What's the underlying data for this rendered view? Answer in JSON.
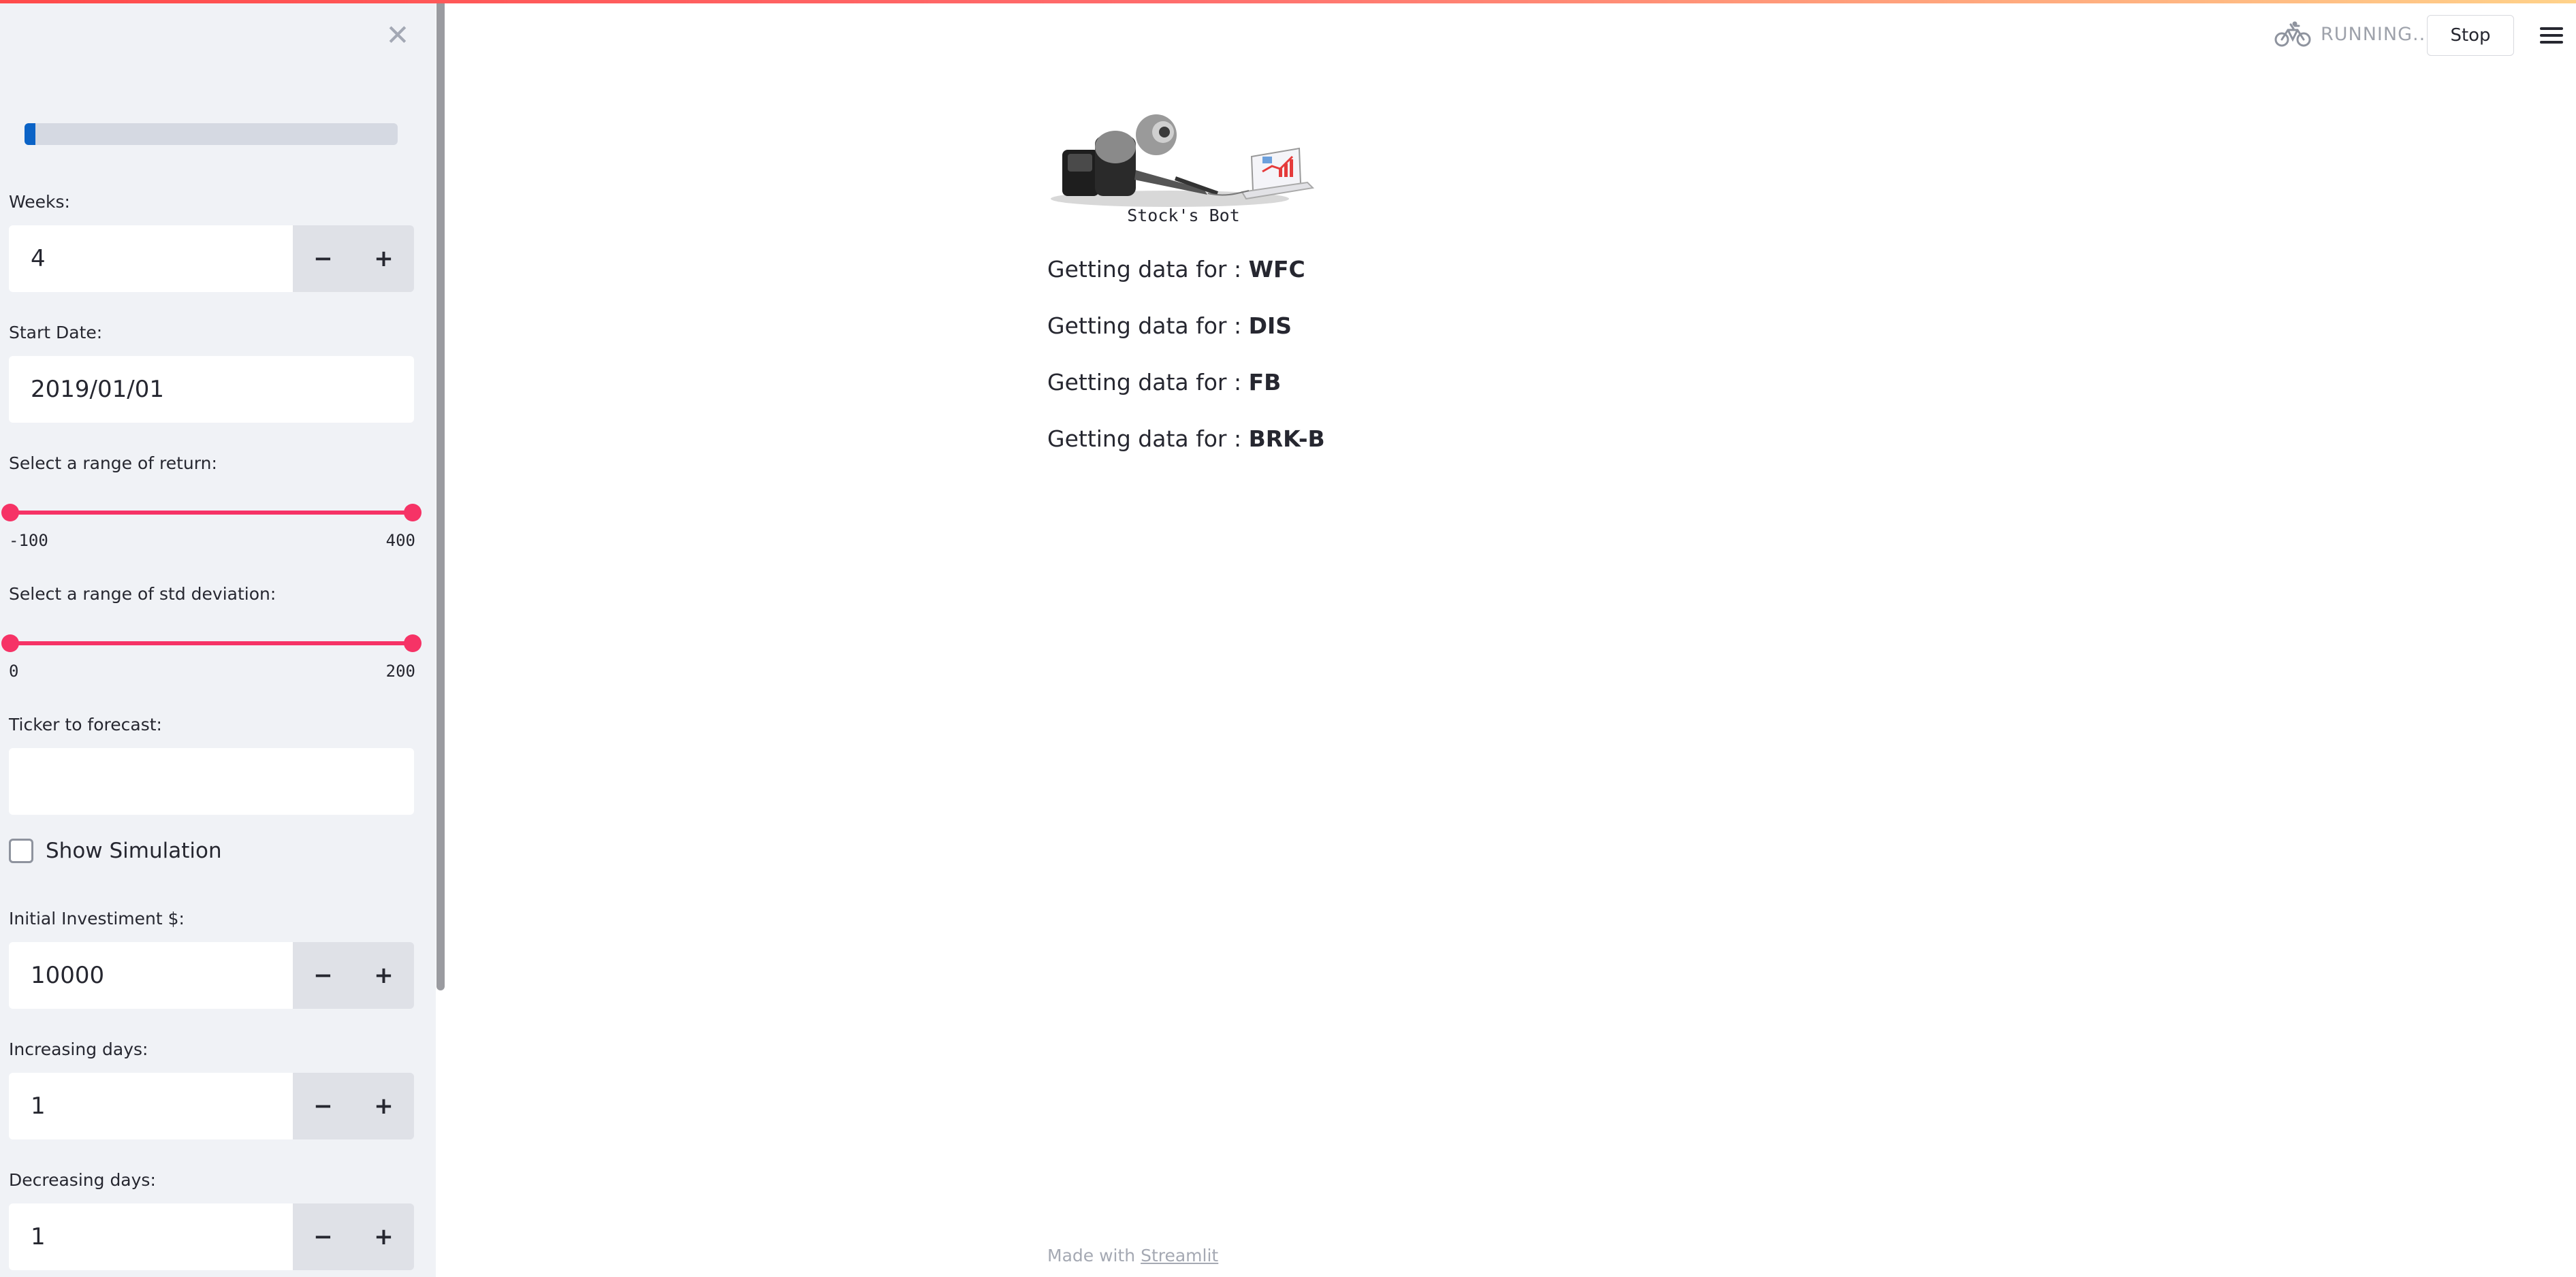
{
  "sidebar": {
    "close_icon": "close-icon",
    "progress_fraction": 0.03,
    "weeks": {
      "label": "Weeks:",
      "value": "4"
    },
    "start_date": {
      "label": "Start Date:",
      "value": "2019/01/01"
    },
    "return_range": {
      "label": "Select a range of return:",
      "min": "-100",
      "max": "400"
    },
    "std_range": {
      "label": "Select a range of std deviation:",
      "min": "0",
      "max": "200"
    },
    "ticker": {
      "label": "Ticker to forecast:",
      "value": ""
    },
    "show_simulation": {
      "label": "Show Simulation",
      "checked": false
    },
    "initial_investment": {
      "label": "Initial Investiment $:",
      "value": "10000"
    },
    "increasing_days": {
      "label": "Increasing days:",
      "value": "1"
    },
    "decreasing_days": {
      "label": "Decreasing days:",
      "value": "1"
    },
    "stepper": {
      "minus": "−",
      "plus": "+"
    }
  },
  "header": {
    "status": "RUNNING...",
    "stop_label": "Stop"
  },
  "main": {
    "logo_caption": "Stock's Bot",
    "messages": [
      {
        "prefix": "Getting data for : ",
        "ticker": "WFC"
      },
      {
        "prefix": "Getting data for : ",
        "ticker": "DIS"
      },
      {
        "prefix": "Getting data for : ",
        "ticker": "FB"
      },
      {
        "prefix": "Getting data for : ",
        "ticker": "BRK-B"
      }
    ]
  },
  "footer": {
    "prefix": "Made with ",
    "link": "Streamlit"
  },
  "colors": {
    "accent": "#f63366",
    "progress": "#0b63c6",
    "sidebar_bg": "#f0f2f6"
  }
}
